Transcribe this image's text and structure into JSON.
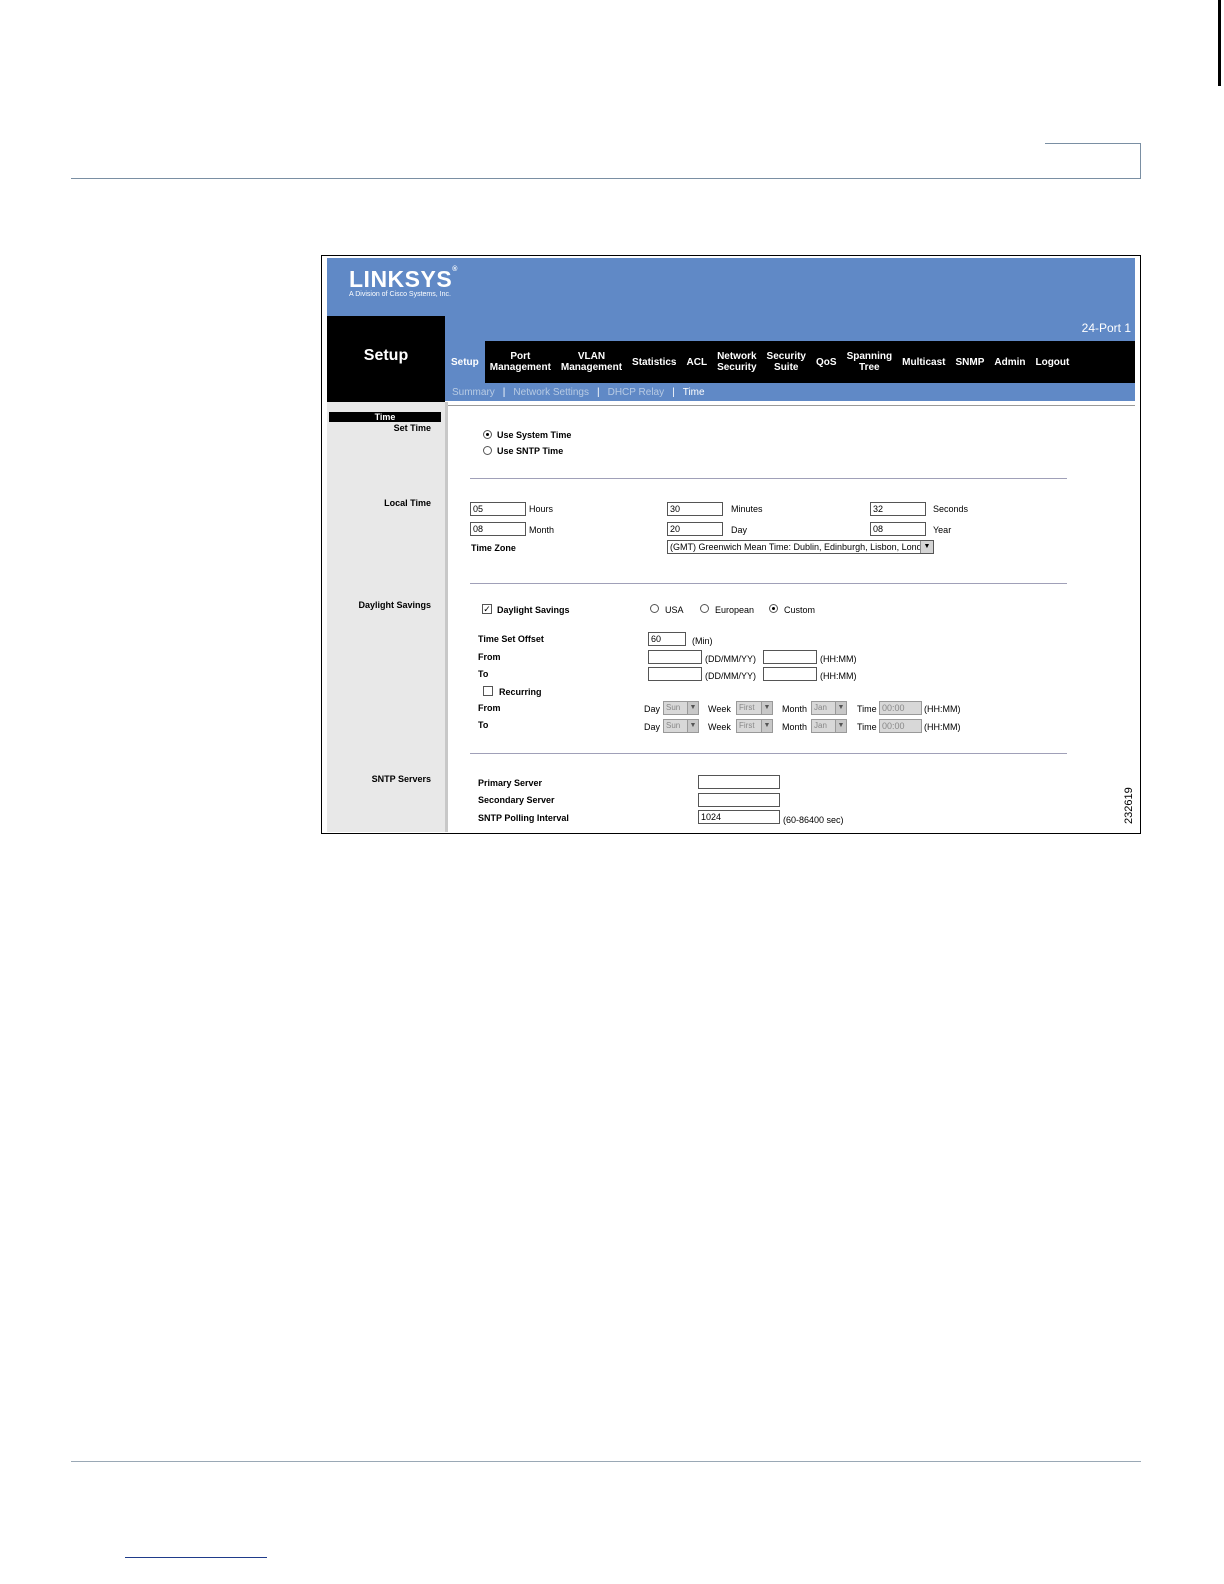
{
  "brand": {
    "logo": "LINKSYS",
    "registered": "®",
    "subtitle": "A Division of Cisco Systems, Inc."
  },
  "product_name": "24-Port 1",
  "section_title": "Setup",
  "figure_id": "232619",
  "nav": {
    "items": [
      {
        "label": "Setup",
        "active": true
      },
      {
        "label": "Port\nManagement"
      },
      {
        "label": "VLAN\nManagement"
      },
      {
        "label": "Statistics"
      },
      {
        "label": "ACL"
      },
      {
        "label": "Network\nSecurity"
      },
      {
        "label": "Security\nSuite"
      },
      {
        "label": "QoS"
      },
      {
        "label": "Spanning\nTree"
      },
      {
        "label": "Multicast"
      },
      {
        "label": "SNMP"
      },
      {
        "label": "Admin"
      },
      {
        "label": "Logout"
      }
    ]
  },
  "sub_nav": {
    "summary": "Summary",
    "network_settings": "Network Settings",
    "dhcp_relay": "DHCP Relay",
    "time": "Time",
    "separator": "|"
  },
  "sidebar": {
    "time": "Time",
    "set_time": "Set Time",
    "local_time": "Local Time",
    "daylight_savings": "Daylight Savings",
    "sntp_servers": "SNTP Servers"
  },
  "set_time": {
    "use_system_time": "Use System Time",
    "use_sntp_time": "Use SNTP Time",
    "selected": "system"
  },
  "local_time": {
    "hours_value": "05",
    "hours_label": "Hours",
    "minutes_value": "30",
    "minutes_label": "Minutes",
    "seconds_value": "32",
    "seconds_label": "Seconds",
    "month_value": "08",
    "month_label": "Month",
    "day_value": "20",
    "day_label": "Day",
    "year_value": "08",
    "year_label": "Year",
    "time_zone_label": "Time Zone",
    "time_zone_value": "(GMT) Greenwich Mean Time: Dublin, Edinburgh, Lisbon, London"
  },
  "daylight_savings": {
    "checkbox_label": "Daylight Savings",
    "checked": true,
    "usa": "USA",
    "european": "European",
    "custom": "Custom",
    "selected_mode": "custom",
    "offset_label": "Time Set Offset",
    "offset_value": "60",
    "offset_unit": "(Min)",
    "from_label": "From",
    "to_label": "To",
    "date_format": "(DD/MM/YY)",
    "time_format": "(HH:MM)",
    "recurring_label": "Recurring",
    "recurring_checked": false,
    "rec_day_label": "Day",
    "rec_day_value": "Sun",
    "rec_week_label": "Week",
    "rec_week_value": "First",
    "rec_month_label": "Month",
    "rec_month_value": "Jan",
    "rec_time_label": "Time",
    "rec_time_value": "00:00",
    "rec_time_format": "(HH:MM)"
  },
  "sntp": {
    "primary_label": "Primary Server",
    "primary_value": "",
    "secondary_label": "Secondary Server",
    "secondary_value": "",
    "polling_label": "SNTP Polling Interval",
    "polling_value": "1024",
    "polling_range": "(60-86400 sec)"
  }
}
